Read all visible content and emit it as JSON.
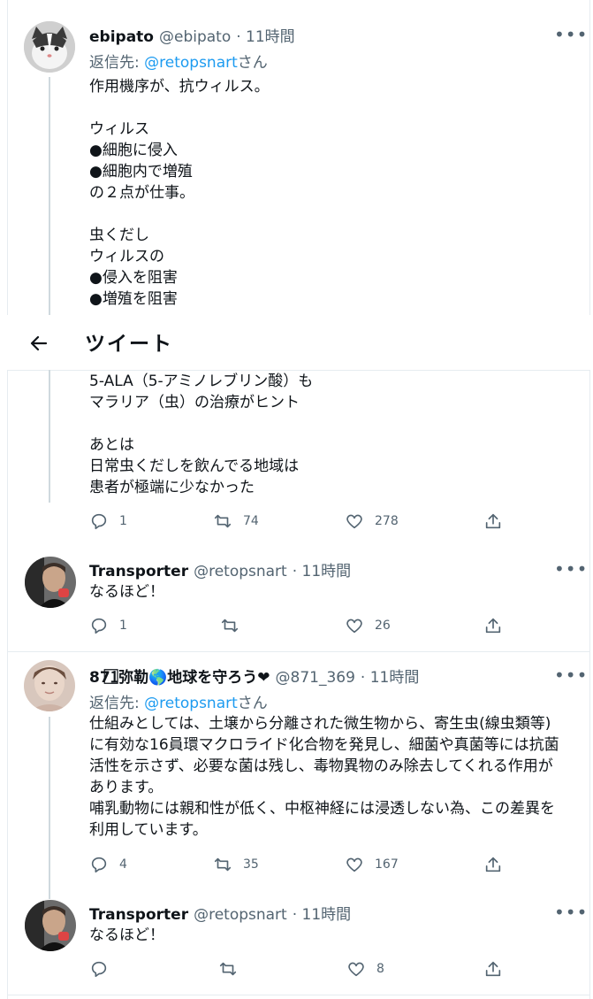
{
  "header": {
    "title": "ツイート"
  },
  "tweets": [
    {
      "name": "ebipato",
      "handle": "@ebipato",
      "time": "· 11時間",
      "reply_prefix": "返信先:",
      "reply_handle": "@retopsnart",
      "reply_suffix": "さん",
      "body_top": "作用機序が、抗ウィルス。\n\nウィルス\n●細胞に侵入\n●細胞内で増殖\nの２点が仕事。\n\n虫くだし\nウィルスの\n●侵入を阻害\n●増殖を阻害",
      "body_bottom": "5-ALA（5-アミノレブリン酸）も\nマラリア（虫）の治療がヒント\n\nあとは\n日常虫くだしを飲んでる地域は\n患者が極端に少なかった",
      "replies": "1",
      "retweets": "74",
      "likes": "278",
      "avatar": "cat-avatar"
    },
    {
      "name": "Transporter",
      "handle": "@retopsnart",
      "time": "· 11時間",
      "body": "なるほど！",
      "replies": "1",
      "retweets": "",
      "likes": "26",
      "avatar": "man-avatar"
    },
    {
      "name": "871⃞弥勒🌎地球を守ろう❤",
      "handle": "@871_369",
      "time": "· 11時間",
      "reply_prefix": "返信先:",
      "reply_handle": "@retopsnart",
      "reply_suffix": "さん",
      "body": "仕組みとしては、土壌から分離された微生物から、寄生虫(線虫類等)に有効な16員環マクロライド化合物を発見し、細菌や真菌等には抗菌活性を示さず、必要な菌は残し、毒物異物のみ除去してくれる作用があります。\n哺乳動物には親和性が低く、中枢神経には浸透しない為、この差異を利用しています。",
      "replies": "4",
      "retweets": "35",
      "likes": "167",
      "avatar": "woman-avatar"
    },
    {
      "name": "Transporter",
      "handle": "@retopsnart",
      "time": "· 11時間",
      "body": "なるほど！",
      "replies": "",
      "retweets": "",
      "likes": "8",
      "avatar": "man-avatar"
    }
  ],
  "colors": {
    "link": "#1d9bf0",
    "text": "#0f1419",
    "muted": "#536471",
    "border": "#e6ecf0"
  }
}
